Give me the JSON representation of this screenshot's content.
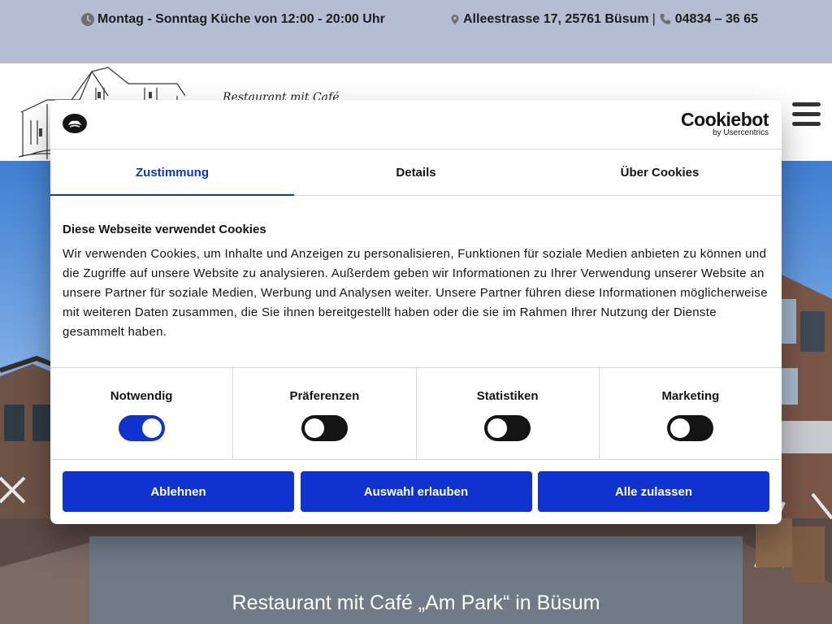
{
  "topbar": {
    "hours": "Montag - Sonntag Küche von 12:00 - 20:00 Uhr",
    "address": "Alleestrasse 17, 25761 Büsum",
    "separator": "|",
    "phone": "04834 – 36 65"
  },
  "header": {
    "logo_text": "Restaurant mit Café"
  },
  "hero": {
    "title": "Restaurant mit Café „Am Park“ in Büsum"
  },
  "cookie_dialog": {
    "brand_name": "Cookiebot",
    "brand_sub": "by Usercentrics",
    "tabs": [
      {
        "label": "Zustimmung",
        "active": true
      },
      {
        "label": "Details",
        "active": false
      },
      {
        "label": "Über Cookies",
        "active": false
      }
    ],
    "heading": "Diese Webseite verwendet Cookies",
    "text": "Wir verwenden Cookies, um Inhalte und Anzeigen zu personalisieren, Funktionen für soziale Medien anbieten zu können und die Zugriffe auf unsere Website zu analysieren. Außerdem geben wir Informationen zu Ihrer Verwendung unserer Website an unsere Partner für soziale Medien, Werbung und Analysen weiter. Unsere Partner führen diese Informationen möglicherweise mit weiteren Daten zusammen, die Sie ihnen bereitgestellt haben oder die sie im Rahmen Ihrer Nutzung der Dienste gesammelt haben.",
    "toggles": [
      {
        "label": "Notwendig",
        "on": true
      },
      {
        "label": "Präferenzen",
        "on": false
      },
      {
        "label": "Statistiken",
        "on": false
      },
      {
        "label": "Marketing",
        "on": false
      }
    ],
    "buttons": {
      "decline": "Ablehnen",
      "allow_selection": "Auswahl erlauben",
      "allow_all": "Alle zulassen"
    }
  },
  "colors": {
    "accent": "#1032cf",
    "topbar_bg": "#b4bdd1"
  }
}
